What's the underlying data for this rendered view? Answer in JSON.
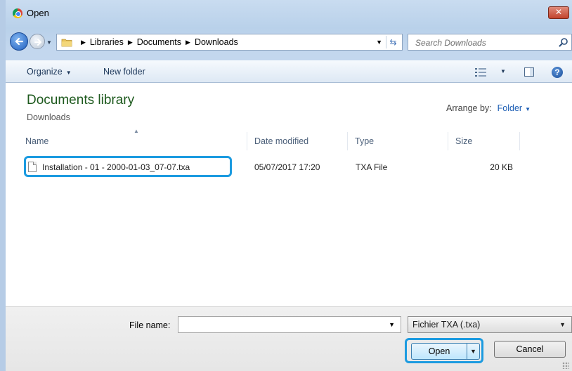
{
  "window": {
    "title": "Open",
    "close_label": "✕"
  },
  "address_bar": {
    "breadcrumbs": [
      "Libraries",
      "Documents",
      "Downloads"
    ],
    "search_placeholder": "Search Downloads"
  },
  "toolbar": {
    "organize_label": "Organize",
    "new_folder_label": "New folder"
  },
  "library": {
    "title": "Documents library",
    "subtitle": "Downloads",
    "arrange_label": "Arrange by:",
    "arrange_value": "Folder"
  },
  "columns": {
    "name": "Name",
    "date": "Date modified",
    "type": "Type",
    "size": "Size"
  },
  "files": [
    {
      "name": "Installation - 01 - 2000-01-03_07-07.txa",
      "date": "05/07/2017 17:20",
      "type": "TXA File",
      "size": "20 KB"
    }
  ],
  "footer": {
    "file_name_label": "File name:",
    "file_name_value": "",
    "file_type": "Fichier TXA (.txa)",
    "open_label": "Open",
    "cancel_label": "Cancel"
  },
  "colors": {
    "highlight": "#1c9be0",
    "library_title": "#1e5a1e",
    "link": "#1e5fb5"
  }
}
